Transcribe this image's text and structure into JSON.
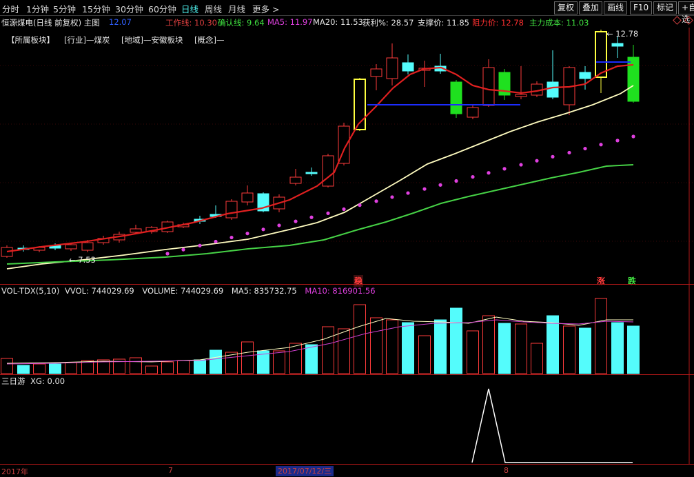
{
  "toolbar": {
    "periods": [
      "分时",
      "1分钟",
      "5分钟",
      "15分钟",
      "30分钟",
      "60分钟",
      "日线",
      "周线",
      "月线",
      "更多 >"
    ],
    "active_period": "日线",
    "right_buttons": [
      "复权",
      "叠加",
      "画线",
      "F10",
      "标记",
      "+自选"
    ]
  },
  "info": {
    "stock": "恒源煤电(日线 前复权) 主图",
    "price": "12.07",
    "work_line": "工作线: 10.30",
    "confirm_line": "确认线: 9.64",
    "ma5": "MA5: 11.97",
    "ma20": "MA20: 11.53",
    "profit": "获利%: 28.57",
    "support": "支撑价: 11.85",
    "resistance": "阻力价: 12.78",
    "main_cost": "主力成本: 11.03"
  },
  "blocks": {
    "title": "【所属板块】",
    "industry": "[行业]—煤炭",
    "region": "[地域]—安徽板块",
    "concept": "[概念]—"
  },
  "price_labels": {
    "high": "12.78",
    "low": "7.53",
    "signal_buy": "稳",
    "signal_up": "涨",
    "signal_down": "跌"
  },
  "volume_panel": {
    "title": "VOL-TDX(5,10)",
    "vvol": "VVOL: 744029.69",
    "volume": "VOLUME: 744029.69",
    "ma5": "MA5: 835732.75",
    "ma10": "MA10: 816901.56"
  },
  "indicator_panel": {
    "title": "三日游",
    "xg": "XG: 0.00"
  },
  "axis": {
    "year": "2017年",
    "month7": "7",
    "cursor_date": "2017/07/12/三",
    "month8": "8"
  },
  "colors": {
    "up": "#ff3b3b",
    "down": "#54fcfc",
    "ma_red": "#e02020",
    "ma_yellow": "#fffcc0",
    "ma_green": "#46d246",
    "dots": "#e040e0",
    "separator": "#b01818"
  }
}
